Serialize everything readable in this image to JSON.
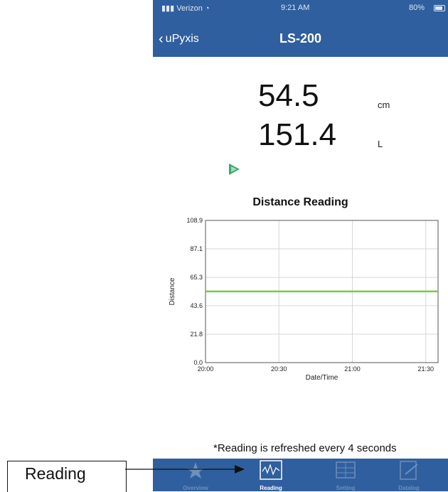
{
  "status_bar": {
    "carrier": "Verizon",
    "time": "9:21 AM",
    "battery": "80%"
  },
  "nav": {
    "back_label": "uPyxis",
    "title": "LS-200"
  },
  "readings": [
    {
      "value": "54.5",
      "unit": "cm"
    },
    {
      "value": "151.4",
      "unit": "L"
    }
  ],
  "colors": {
    "header": "#2f5f9e",
    "series": "#7ac943",
    "indicator": "#3aa76d"
  },
  "chart_data": {
    "type": "line",
    "title": "Distance Reading",
    "xlabel": "Date/Time",
    "ylabel": "Distance",
    "x_ticks": [
      "20:00",
      "20:30",
      "21:00",
      "21:30"
    ],
    "y_ticks": [
      "0.0",
      "21.8",
      "43.6",
      "65.3",
      "87.1",
      "108.9"
    ],
    "ylim": [
      0,
      108.9
    ],
    "xlim": [
      "20:00",
      "21:35"
    ],
    "grid": true,
    "series": [
      {
        "x": [
          "20:00",
          "21:35"
        ],
        "values": [
          54.5,
          54.5
        ]
      }
    ]
  },
  "note": "*Reading is refreshed every 4 seconds",
  "tabs": [
    {
      "label": "Overview",
      "icon": "star-icon"
    },
    {
      "label": "Reading",
      "icon": "waveform-icon"
    },
    {
      "label": "Setting",
      "icon": "grid-icon"
    },
    {
      "label": "Datalog",
      "icon": "edit-document-icon"
    }
  ],
  "callout": {
    "label": "Reading"
  }
}
